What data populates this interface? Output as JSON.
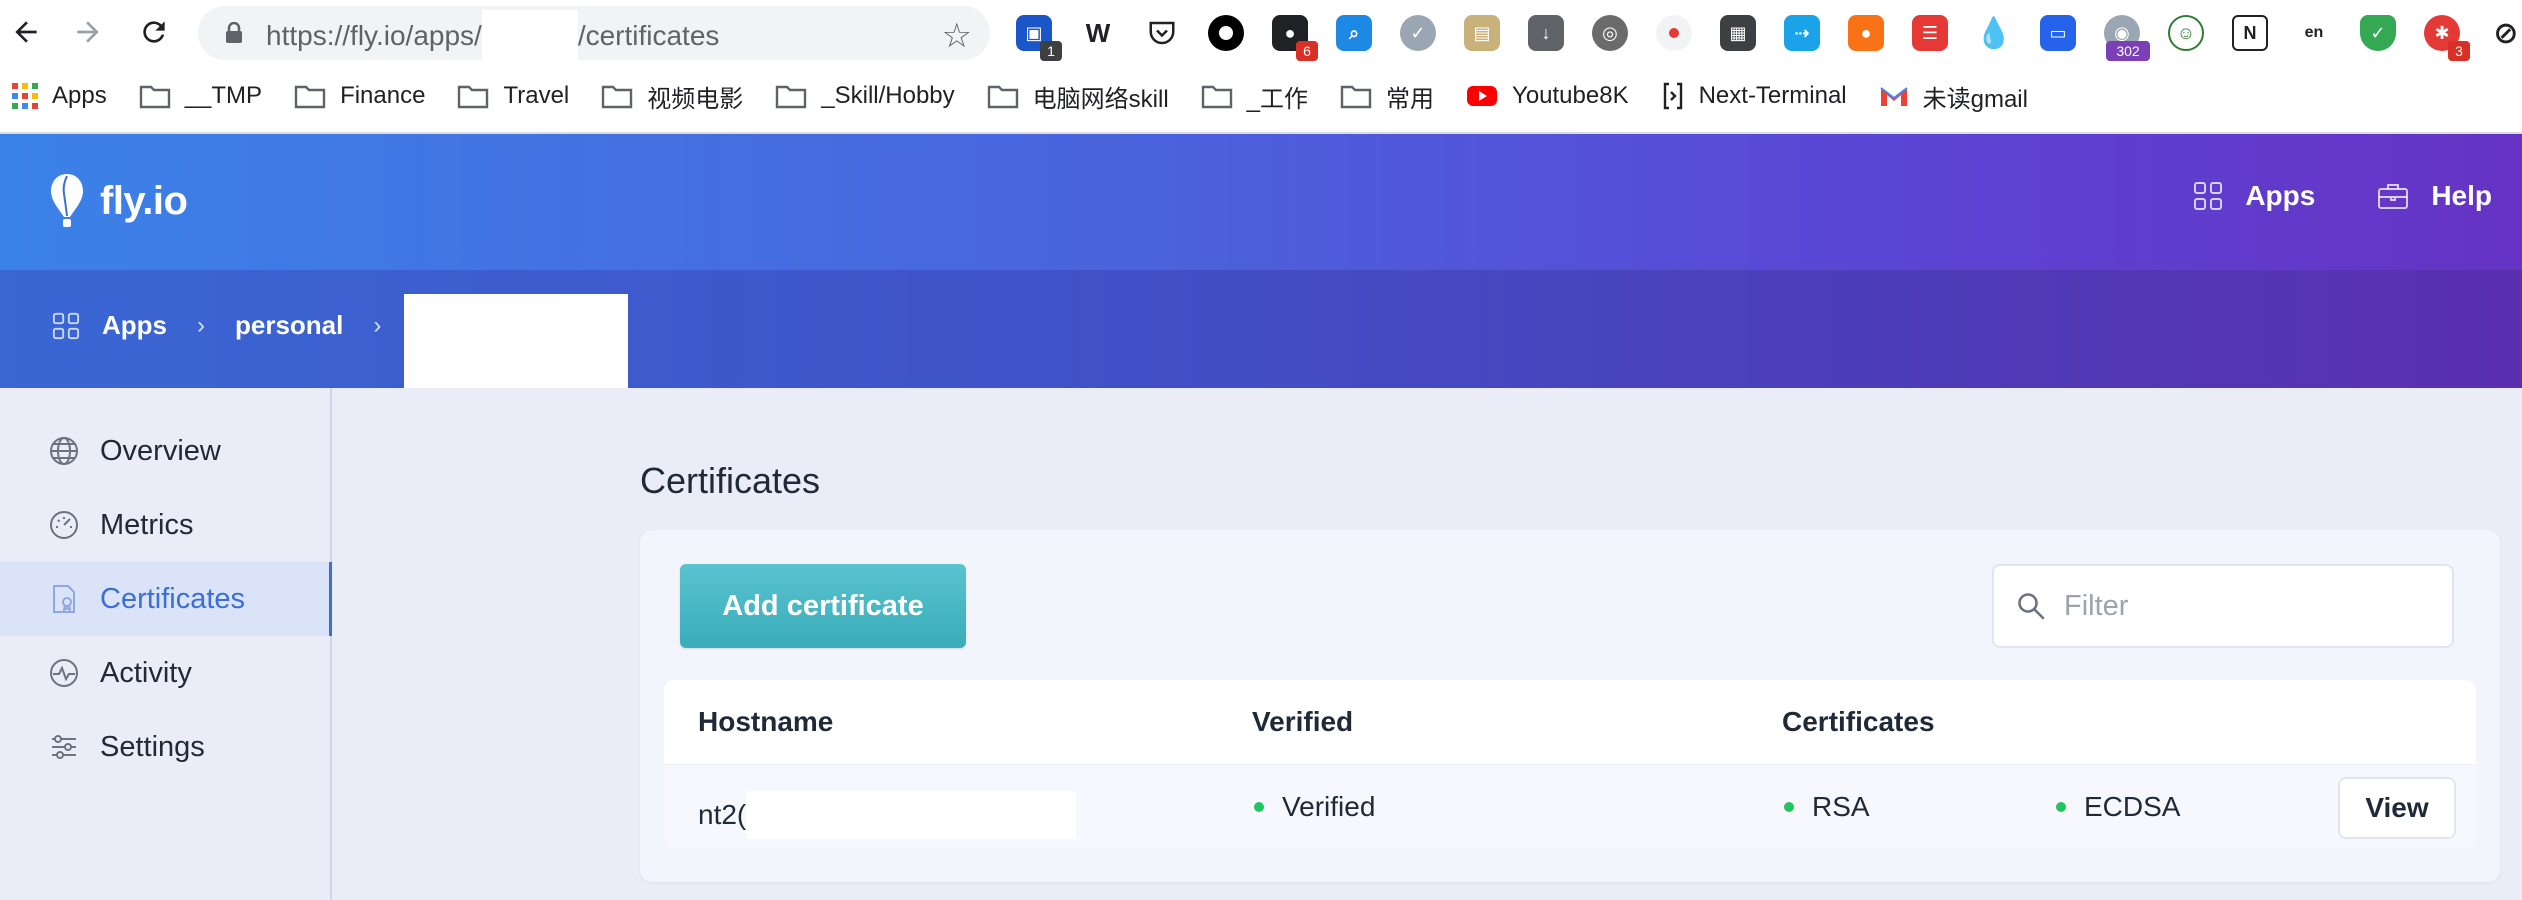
{
  "browser": {
    "url_prefix": "https://fly.io/apps/",
    "url_suffix": "/certificates",
    "bookmarks": [
      {
        "label": "Apps",
        "icon": "apps-grid-icon"
      },
      {
        "label": "__TMP",
        "icon": "folder-icon"
      },
      {
        "label": "Finance",
        "icon": "folder-icon"
      },
      {
        "label": "Travel",
        "icon": "folder-icon"
      },
      {
        "label": "视频电影",
        "icon": "folder-icon"
      },
      {
        "label": "_Skill/Hobby",
        "icon": "folder-icon"
      },
      {
        "label": "电脑网络skill",
        "icon": "folder-icon"
      },
      {
        "label": "_工作",
        "icon": "folder-icon"
      },
      {
        "label": "常用",
        "icon": "folder-icon"
      },
      {
        "label": "Youtube8K",
        "icon": "youtube-icon"
      },
      {
        "label": "Next-Terminal",
        "icon": "terminal-icon"
      },
      {
        "label": "未读gmail",
        "icon": "gmail-icon"
      }
    ],
    "extension_badges": {
      "first": "1",
      "second": "6",
      "third": "302",
      "fourth": "3"
    }
  },
  "header": {
    "brand": "fly.io",
    "nav": {
      "apps": "Apps",
      "help": "Help"
    }
  },
  "breadcrumb": {
    "apps": "Apps",
    "org": "personal"
  },
  "sidebar": {
    "items": [
      {
        "label": "Overview",
        "icon": "globe-icon"
      },
      {
        "label": "Metrics",
        "icon": "gauge-icon"
      },
      {
        "label": "Certificates",
        "icon": "certificate-icon"
      },
      {
        "label": "Activity",
        "icon": "activity-icon"
      },
      {
        "label": "Settings",
        "icon": "sliders-icon"
      }
    ],
    "active": "Certificates"
  },
  "main": {
    "title": "Certificates",
    "add_button": "Add certificate",
    "filter_placeholder": "Filter",
    "table": {
      "headers": {
        "hostname": "Hostname",
        "verified": "Verified",
        "certificates": "Certificates"
      },
      "rows": [
        {
          "hostname": "nt2(",
          "verified": "Verified",
          "cert_rsa": "RSA",
          "cert_ecdsa": "ECDSA",
          "action": "View"
        }
      ]
    }
  },
  "colors": {
    "header_start": "#3b82e8",
    "header_end": "#6633c4",
    "accent": "#3b6fd4",
    "add_button": "#3aacba",
    "status_green": "#22c55e"
  }
}
